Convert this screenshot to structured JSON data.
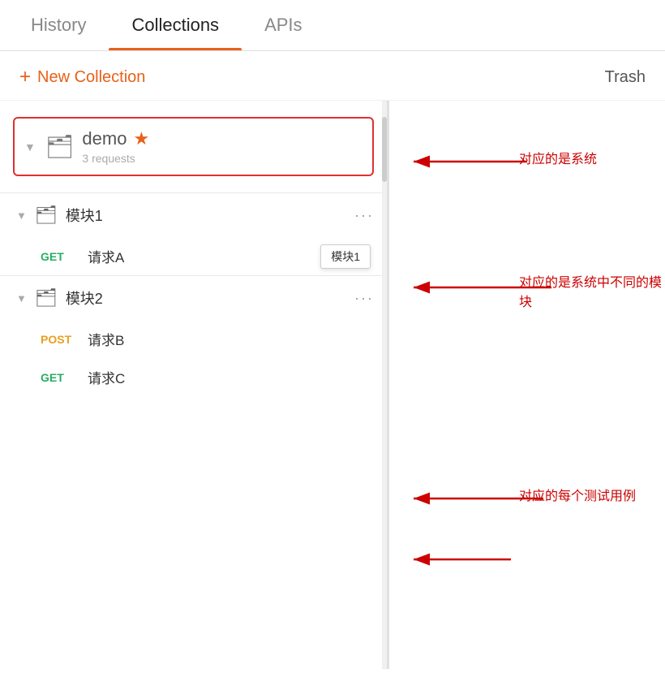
{
  "tabs": [
    {
      "id": "history",
      "label": "History",
      "active": false
    },
    {
      "id": "collections",
      "label": "Collections",
      "active": true
    },
    {
      "id": "apis",
      "label": "APIs",
      "active": false
    }
  ],
  "toolbar": {
    "new_collection_label": "New Collection",
    "plus_symbol": "+",
    "trash_label": "Trash"
  },
  "demo_collection": {
    "name": "demo",
    "star": "★",
    "request_count": "3 requests"
  },
  "modules": [
    {
      "name": "模块1",
      "requests": [
        {
          "method": "GET",
          "name": "请求A",
          "tooltip": "模块1"
        }
      ]
    },
    {
      "name": "模块2",
      "requests": [
        {
          "method": "POST",
          "name": "请求B"
        },
        {
          "method": "GET",
          "name": "请求C"
        }
      ]
    }
  ],
  "annotations": [
    {
      "text": "对应的是系统",
      "arrow_target": "demo"
    },
    {
      "text": "对应的是系统中不同的模块",
      "arrow_target": "module1"
    },
    {
      "text": "对应的每个测试用例",
      "arrow_target": "requestB"
    }
  ],
  "colors": {
    "active_tab_underline": "#e8611a",
    "new_collection": "#e8611a",
    "annotation_red": "#cc0000",
    "method_get": "#27ae60",
    "method_post": "#e8a020",
    "star": "#e8611a"
  },
  "icons": {
    "folder": "📁",
    "chevron_right": "▶",
    "chevron_down": "▼",
    "dots": "···"
  }
}
